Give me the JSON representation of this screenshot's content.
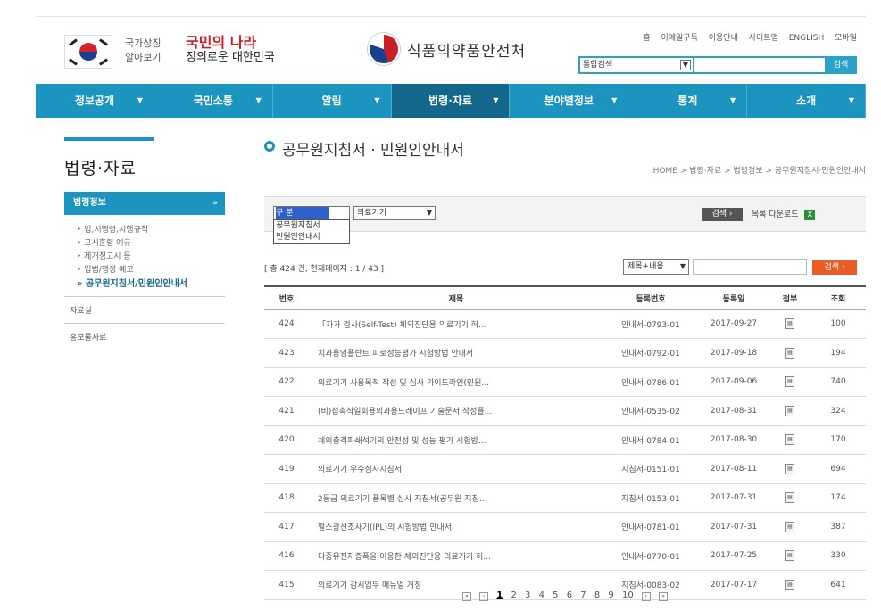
{
  "header": {
    "national_symbol": [
      "국가상징",
      "알아보기"
    ],
    "slogan": [
      "국민의 나라",
      "정의로운 대한민국"
    ],
    "agency_name": "식품의약품안전처",
    "util_links": [
      "홈",
      "이메일구독",
      "이용안내",
      "사이트맵",
      "ENGLISH",
      "모바일"
    ],
    "search": {
      "scope": "통합검색",
      "button": "검색"
    }
  },
  "nav": {
    "items": [
      {
        "label": "정보공개"
      },
      {
        "label": "국민소통"
      },
      {
        "label": "알림"
      },
      {
        "label": "법령·자료"
      },
      {
        "label": "분야별정보"
      },
      {
        "label": "통계"
      },
      {
        "label": "소개"
      }
    ],
    "active_index": 3
  },
  "sidebar": {
    "title": "법령·자료",
    "menu_header": "법령정보",
    "menu_header_arrow": "»",
    "sub_items": [
      "법,시행령,시행규칙",
      "고시훈령 예규",
      "제개정고시 등",
      "입법/행정 예고",
      "공무원지침서/민원인안내서"
    ],
    "other_menus": [
      "자료실",
      "홍보물자료"
    ]
  },
  "main": {
    "page_title": "공무원지침서 · 민원인안내서",
    "breadcrumb": "HOME > 법령·자료 > 법령정보 > 공무원지침서·민원인안내서",
    "filter": {
      "category_selected": "구 분",
      "category_options": [
        "공무원지침서",
        "민원인안내서"
      ],
      "product_selected": "의료기기",
      "search_button": "검색",
      "download_label": "목록 다운로드"
    },
    "total_text": "[ 총 424 건, 현재페이지 : 1 / 43 ]",
    "search_field": "제목+내용",
    "search_button": "검색"
  },
  "table": {
    "headers": [
      "번호",
      "제목",
      "등록번호",
      "등록일",
      "첨부",
      "조회"
    ],
    "rows": [
      {
        "no": "424",
        "title": "「자가 검사(Self-Test) 체외진단용 의료기기 허...",
        "reg": "안내서-0793-01",
        "date": "2017-09-27",
        "views": "100"
      },
      {
        "no": "423",
        "title": "치과용임플란트 피로성능평가 시험방법 안내서",
        "reg": "안내서-0792-01",
        "date": "2017-09-18",
        "views": "194"
      },
      {
        "no": "422",
        "title": "의료기기 사용목적 작성 및 심사 가이드라인(민원...",
        "reg": "안내서-0786-01",
        "date": "2017-09-06",
        "views": "740"
      },
      {
        "no": "421",
        "title": "(비)접촉식일회용외과용드레이프 기술문서 작성플...",
        "reg": "안내서-0535-02",
        "date": "2017-08-31",
        "views": "324"
      },
      {
        "no": "420",
        "title": "체외충격파쇄석기의 안전성 및 성능 평가 시험방...",
        "reg": "안내서-0784-01",
        "date": "2017-08-30",
        "views": "170"
      },
      {
        "no": "419",
        "title": "의료기기 우수심사지침서",
        "reg": "지침서-0151-01",
        "date": "2017-08-11",
        "views": "694"
      },
      {
        "no": "418",
        "title": "2등급 의료기기 품목별 심사 지침서(공무원 지침...",
        "reg": "지침서-0153-01",
        "date": "2017-07-31",
        "views": "174"
      },
      {
        "no": "417",
        "title": "펄스광선조사기(IPL)의 시험방법 안내서",
        "reg": "안내서-0781-01",
        "date": "2017-07-31",
        "views": "387"
      },
      {
        "no": "416",
        "title": "다중유전자증폭을 이용한 체외진단용 의료기기 허...",
        "reg": "안내서-0770-01",
        "date": "2017-07-25",
        "views": "330"
      },
      {
        "no": "415",
        "title": "의료기기 감시업무 매뉴얼 개정",
        "reg": "지침서-0083-02",
        "date": "2017-07-17",
        "views": "641"
      }
    ]
  },
  "pagination": {
    "pages": [
      "1",
      "2",
      "3",
      "4",
      "5",
      "6",
      "7",
      "8",
      "9",
      "10"
    ],
    "current": "1"
  },
  "colors": {
    "nav": "#1b95bf",
    "nav_active": "#13678a",
    "accent_orange": "#e85d27"
  }
}
